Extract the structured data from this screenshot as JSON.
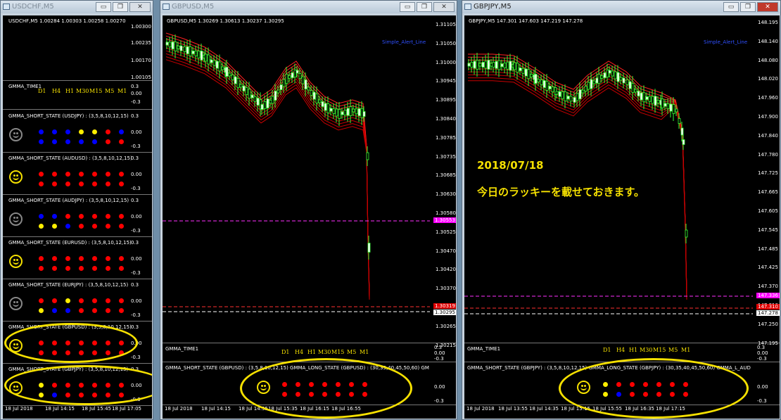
{
  "windows": {
    "w1": {
      "title": "USDCHF,M5",
      "chart_label": "USDCHF,M5  1.00284 1.00303 1.00258 1.00270",
      "y_ticks": [
        "1.00300",
        "1.00235",
        "1.00170",
        "1.00105"
      ],
      "x_ticks": [
        "18 Jul 2018",
        "18 Jul 14:15",
        "18 Jul 15:45",
        "18 Jul 17:05"
      ]
    },
    "w2": {
      "title": "GBPUSD,M5",
      "chart_label": "GBPUSD,M5  1.30269 1.30613 1.30237 1.30295",
      "alert": "Simple_Alert_Line",
      "y_ticks": [
        "1.31105",
        "1.31050",
        "1.31000",
        "1.30945",
        "1.30895",
        "1.30840",
        "1.30785",
        "1.30735",
        "1.30685",
        "1.30630",
        "1.30580",
        "1.30525",
        "1.30470",
        "1.30420",
        "1.30370",
        "1.30315",
        "1.30265",
        "1.30215"
      ],
      "price_tags": {
        "magenta": "1.30553",
        "red": "1.30319",
        "white": "1.30295"
      },
      "x_ticks": [
        "18 Jul 2018",
        "18 Jul 14:15",
        "18 Jul 14:55",
        "18 Jul 15:35",
        "18 Jul 16:15",
        "18 Jul 16:55"
      ]
    },
    "w3": {
      "title": "GBPJPY,M5",
      "chart_label": "GBPJPY,M5  147.301 147.603 147.219 147.278",
      "alert": "Simple_Alert_Line",
      "y_ticks": [
        "148.195",
        "148.140",
        "148.080",
        "148.020",
        "147.960",
        "147.900",
        "147.840",
        "147.780",
        "147.725",
        "147.665",
        "147.605",
        "147.545",
        "147.485",
        "147.425",
        "147.370",
        "147.310",
        "147.250",
        "147.195"
      ],
      "price_tags": {
        "magenta": "147.336",
        "red": "147.310",
        "white": "147.278"
      },
      "x_ticks": [
        "18 Jul 2018",
        "18 Jul 13:55",
        "18 Jul 14:35",
        "18 Jul 15:15",
        "18 Jul 15:55",
        "18 Jul 16:35",
        "18 Jul 17:15"
      ]
    }
  },
  "note": {
    "date": "2018/07/18",
    "text": "今日のラッキーを載せておきます。"
  },
  "gmma_time": {
    "label": "GMMA_TIME1",
    "frames": [
      "D1",
      "H4",
      "H1",
      "M30",
      "M15",
      "M5",
      "M1"
    ],
    "scale": [
      "0.3",
      "0.00",
      "-0.3"
    ]
  },
  "gmma_panels": [
    {
      "label": "GMMA_SHORT_STATE (USDJPY) : (3,5,8,10,12,15)"
    },
    {
      "label": "GMMA_SHORT_STATE (AUDUSD) : (3,5,8,10,12,15)"
    },
    {
      "label": "GMMA_SHORT_STATE (AUDJPY) : (3,5,8,10,12,15)"
    },
    {
      "label": "GMMA_SHORT_STATE (EURUSD) : (3,5,8,10,12,15)"
    },
    {
      "label": "GMMA_SHORT_STATE (EURJPY) : (3,5,8,10,12,15)"
    },
    {
      "label": "GMMA_SHORT_STATE (GBPUSD) : (3,5,8,10,12,15)"
    },
    {
      "label": "GMMA_SHORT_STATE (GBPJPY) : (3,5,8,10,12,15)"
    }
  ],
  "w2_bottom_label": "GMMA_SHORT_STATE (GBPUSD) : (3,5,8,10,12,15)  GMMA_LONG_STATE (GBPUSD) : (30,35,40,45,50,60)  GM",
  "w3_bottom_label": "GMMA_SHORT_STATE (GBPJPY) : (3,5,8,10,12,15)  GMMA_LONG_STATE (GBPJPY) : (30,35,40,45,50,60)  GMMA_L_AUD",
  "colors": {
    "red": "#ff0000",
    "blue": "#0000ff",
    "yellow": "#ffee00",
    "magenta": "#ff00ff",
    "accent": "#f5e000"
  }
}
